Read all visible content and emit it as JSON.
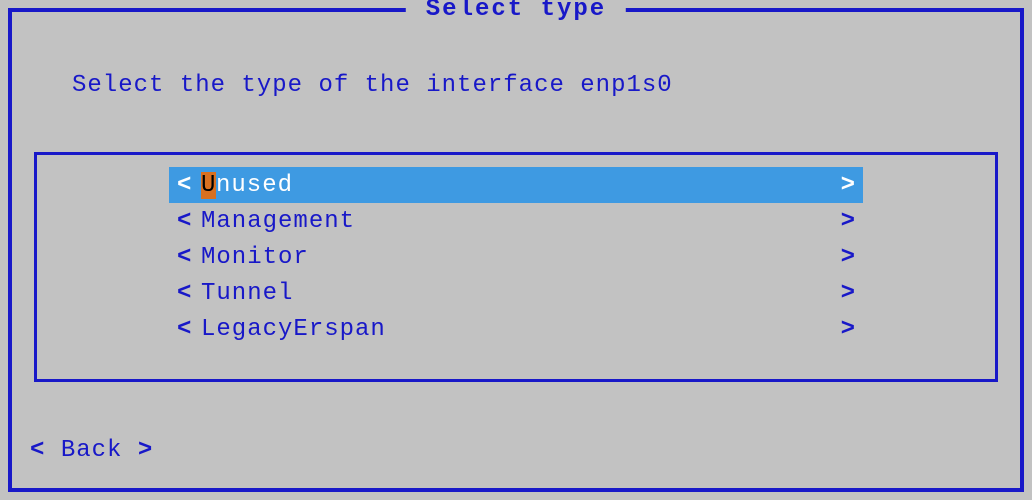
{
  "dialog": {
    "title": "Select type",
    "prompt": "Select the type of the interface enp1s0"
  },
  "options": {
    "items": [
      {
        "hotkey": "U",
        "rest": "nused",
        "selected": true
      },
      {
        "label": "Management",
        "selected": false
      },
      {
        "label": "Monitor",
        "selected": false
      },
      {
        "label": "Tunnel",
        "selected": false
      },
      {
        "label": "LegacyErspan",
        "selected": false
      }
    ]
  },
  "footer": {
    "back_label": "Back"
  },
  "glyphs": {
    "chevron_left": "<",
    "chevron_right": ">"
  }
}
